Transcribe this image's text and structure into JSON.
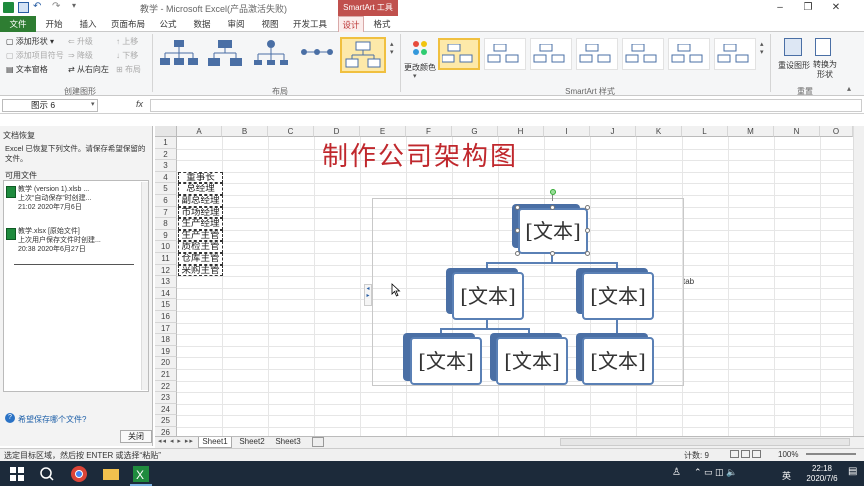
{
  "window": {
    "title": "教学 - Microsoft Excel(产品激活失败)",
    "context_tab": "SmartArt 工具"
  },
  "tabs": [
    "文件",
    "开始",
    "插入",
    "页面布局",
    "公式",
    "数据",
    "审阅",
    "视图",
    "开发工具",
    "设计",
    "格式"
  ],
  "ribbon": {
    "create_group": {
      "buttons": [
        "添加形状",
        "添加项目符号",
        "文本窗格",
        "升级",
        "降级",
        "从右向左",
        "上移",
        "下移",
        "布局"
      ],
      "label": "创建图形"
    },
    "layout_label": "布局",
    "change_colors": "更改颜色",
    "styles_label": "SmartArt 样式",
    "reset_graphic": "重设图形",
    "convert_to_shape": "转换为形状",
    "reset_label": "重置"
  },
  "formula_bar": {
    "name_box": "图示 6",
    "fx": "fx",
    "value": ""
  },
  "recovery": {
    "title": "文档恢复",
    "message": "Excel 已恢复下列文件。请保存希望保留的文件。",
    "available": "可用文件",
    "files": [
      {
        "name": "教学 (version 1).xlsb ...",
        "desc": "上次“自动保存”时创建...",
        "time": "21:02 2020年7月6日"
      },
      {
        "name": "教学.xlsx [原始文件]",
        "desc": "上次用户保存文件时创建...",
        "time": "20:38 2020年6月27日"
      }
    ],
    "help": "希望保存哪个文件?",
    "close": "关闭"
  },
  "grid": {
    "columns": [
      "A",
      "B",
      "C",
      "D",
      "E",
      "F",
      "G",
      "H",
      "I",
      "J",
      "K",
      "L",
      "M",
      "N",
      "O"
    ],
    "rows": [
      "1",
      "2",
      "3",
      "4",
      "5",
      "6",
      "7",
      "8",
      "9",
      "10",
      "11",
      "12",
      "13",
      "14",
      "15",
      "16",
      "17",
      "18",
      "19",
      "20",
      "21",
      "22",
      "23",
      "24",
      "25",
      "26"
    ],
    "title": "制作公司架构图",
    "cells": [
      "董事长",
      "总经理",
      "副总经理",
      "市场经理",
      "生产经理",
      "生产主管",
      "质检主管",
      "仓库主管",
      "采购主管"
    ],
    "stray_text": "tab"
  },
  "smartart": {
    "nodes": [
      "[文本]",
      "[文本]",
      "[文本]",
      "[文本]",
      "[文本]",
      "[文本]"
    ]
  },
  "sheets": [
    "Sheet1",
    "Sheet2",
    "Sheet3"
  ],
  "status": {
    "message": "选定目标区域，然后按 ENTER 或选择“粘贴”",
    "count": "计数: 9",
    "zoom": "100%"
  },
  "taskbar": {
    "time": "22:18",
    "date": "2020/7/6",
    "language": "英"
  }
}
